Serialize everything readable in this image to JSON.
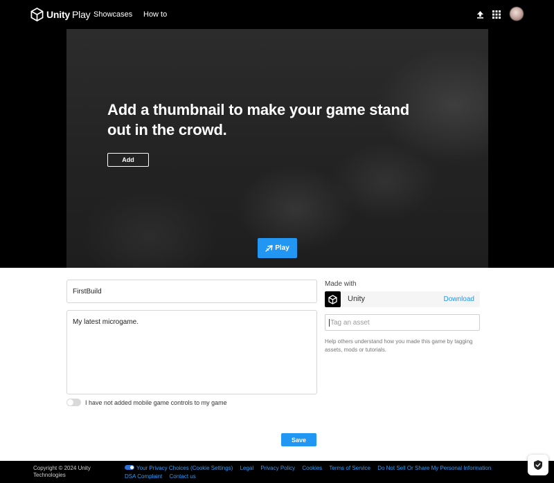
{
  "header": {
    "brand_bold": "Unity",
    "brand_thin": "Play",
    "nav": [
      {
        "label": "Showcases"
      },
      {
        "label": "How to"
      }
    ],
    "icons": [
      "upload-icon",
      "apps-grid-icon",
      "avatar"
    ]
  },
  "hero": {
    "title": "Add a thumbnail to make your game stand out in the crowd.",
    "add_label": "Add",
    "play_label": "Play"
  },
  "form": {
    "title_value": "FirstBuild",
    "description_value": "My latest microgame.",
    "mobile_controls_label": "I have not added mobile game controls to my game",
    "made_with_label": "Made with",
    "engine_name": "Unity",
    "download_label": "Download",
    "tag_placeholder": "Tag an asset",
    "help_text": "Help others understand how you made this game by tagging assets, mods or tutorials.",
    "save_label": "Save"
  },
  "footer": {
    "copyright": "Copyright © 2024 Unity Technologies",
    "links": [
      {
        "label": "Your Privacy Choices (Cookie Settings)"
      },
      {
        "label": "Legal"
      },
      {
        "label": "Privacy Policy"
      },
      {
        "label": "Cookies"
      },
      {
        "label": "Terms of Service"
      },
      {
        "label": "Do Not Sell Or Share My Personal Information"
      },
      {
        "label": "DSA Complaint"
      },
      {
        "label": "Contact us"
      }
    ]
  },
  "colors": {
    "accent": "#2196f3",
    "header_bg": "#000000",
    "link": "#2f9cf5"
  }
}
